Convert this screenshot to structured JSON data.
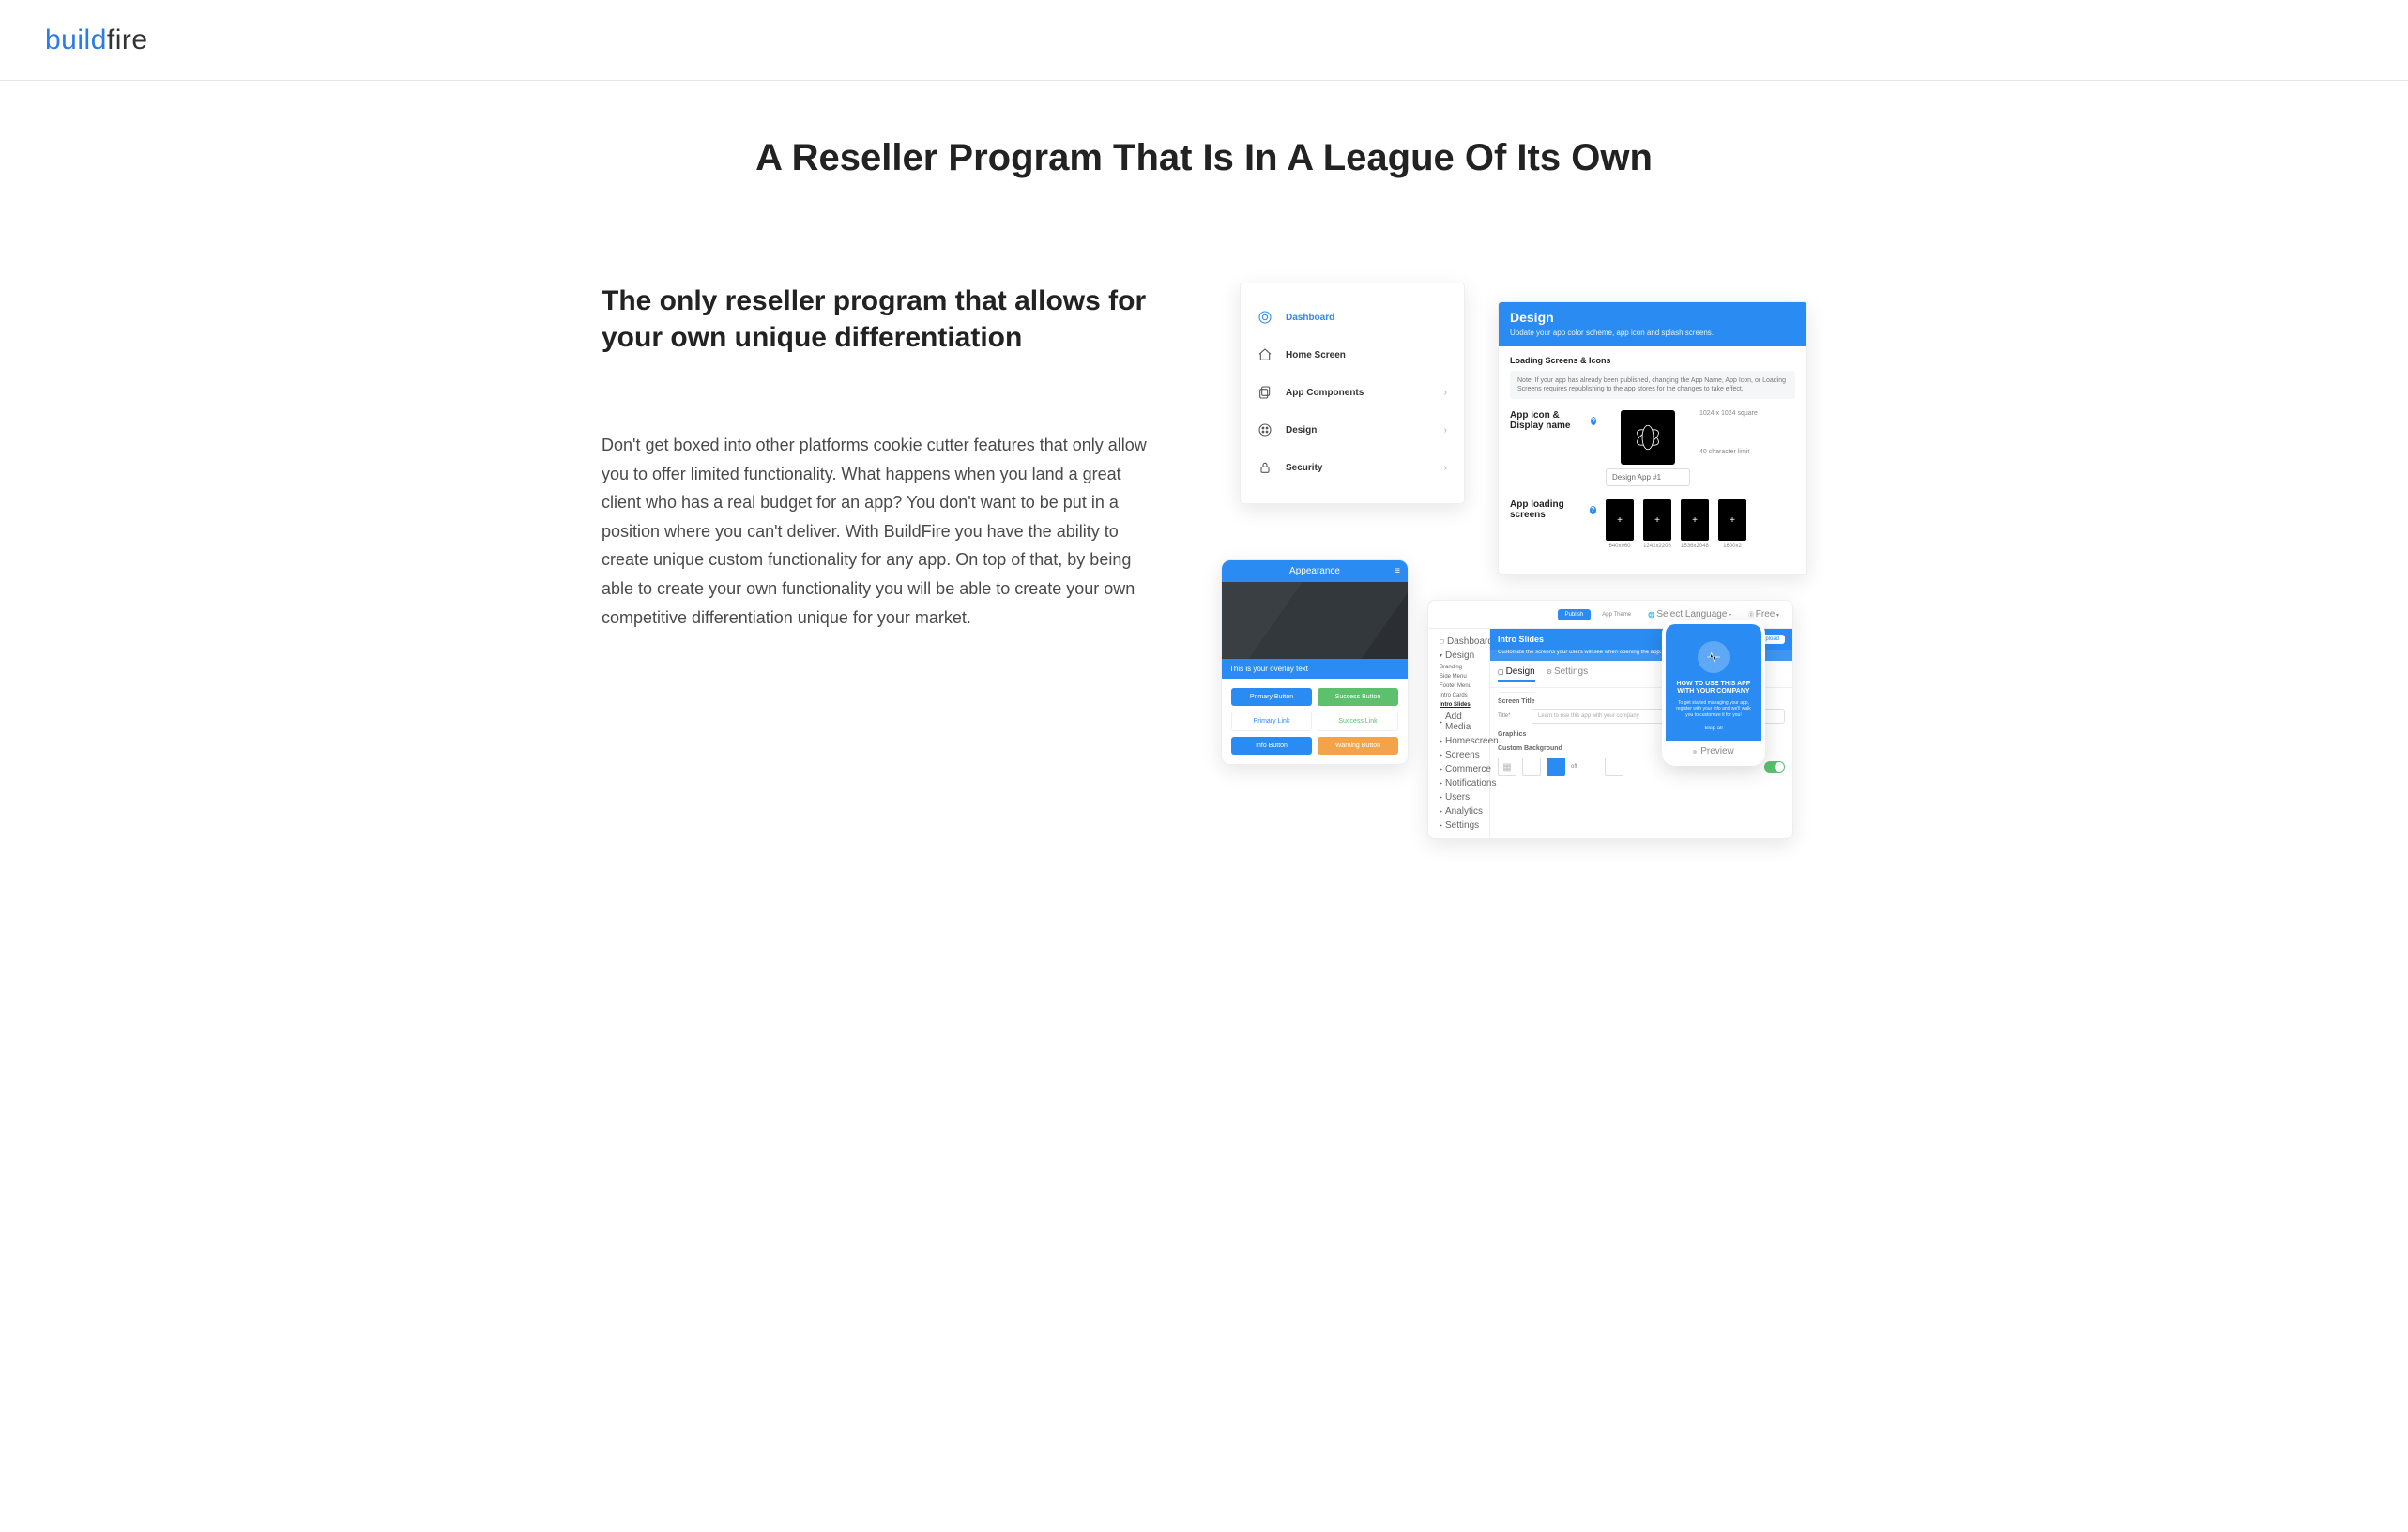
{
  "brand": {
    "part1": "build",
    "part2": "fire"
  },
  "headline": "A Reseller Program That Is In A League Of Its Own",
  "subheading": "The only reseller program that allows for your own unique differentiation",
  "body": "Don't get boxed into other platforms cookie cutter features that only allow you to offer limited functionality. What happens when you land a great client who has a real budget for an app? You don't want to be put in a position where you can't deliver. With BuildFire you have the ability to create unique custom functionality for any app. On top of that, by being able to create your own functionality you will be able to create your own competitive differentiation unique for your market.",
  "nav": {
    "items": [
      {
        "label": "Dashboard",
        "active": true,
        "chevron": false
      },
      {
        "label": "Home Screen",
        "active": false,
        "chevron": false
      },
      {
        "label": "App Components",
        "active": false,
        "chevron": true
      },
      {
        "label": "Design",
        "active": false,
        "chevron": true
      },
      {
        "label": "Security",
        "active": false,
        "chevron": true
      }
    ]
  },
  "design_panel": {
    "title": "Design",
    "subtitle": "Update your app color scheme, app icon and splash screens.",
    "section": "Loading Screens & Icons",
    "note": "Note: If your app has already been published, changing the App Name, App Icon, or Loading Screens requires republishing to the app stores for the changes to take effect.",
    "row1_label": "App icon & Display name",
    "icon_dim": "1024 x 1024 square",
    "display_name": "Design App #1",
    "char_note": "40 character limit",
    "row2_label": "App loading screens",
    "thumbs": [
      "640x960",
      "1242x2208",
      "1536x2048",
      "1600x2"
    ]
  },
  "phone": {
    "title": "Appearance",
    "overlay": "This is your overlay text",
    "buttons": [
      "Primary Button",
      "Success Button",
      "Primary Link",
      "Success Link",
      "Info Button",
      "Warning Button"
    ]
  },
  "dash": {
    "top": {
      "publish": "Publish",
      "theme": "App Theme",
      "lang": "Select Language",
      "plan": "Free"
    },
    "side": {
      "s1": "Dashboard",
      "s2": "Design",
      "items2": [
        "Branding",
        "Side Menu",
        "Footer Menu",
        "Intro Cards",
        "Intro Slides"
      ],
      "s3": "Add Media",
      "s4": "Homescreen",
      "s5": "Screens",
      "s6": "Commerce",
      "s7": "Notifications",
      "s8": "Users",
      "s9": "Analytics",
      "s10": "Settings"
    },
    "hero": {
      "title": "Intro Slides",
      "sub": "Customize the screens your users will see when opening the app.",
      "upload": "Upload"
    },
    "tabs": [
      "Design",
      "Settings"
    ],
    "screen_title_label": "Screen Title",
    "title_label": "Title*",
    "title_placeholder": "Learn to use this app with your company",
    "graphics_label": "Graphics",
    "custom_bg_label": "Custom Background",
    "off": "off"
  },
  "mini": {
    "heading": "HOW TO USE THIS APP WITH YOUR COMPANY",
    "para": "To get started managing your app, register with your info and we'll walk you to customize it for you!",
    "skip": "Skip all",
    "preview": "Preview"
  }
}
